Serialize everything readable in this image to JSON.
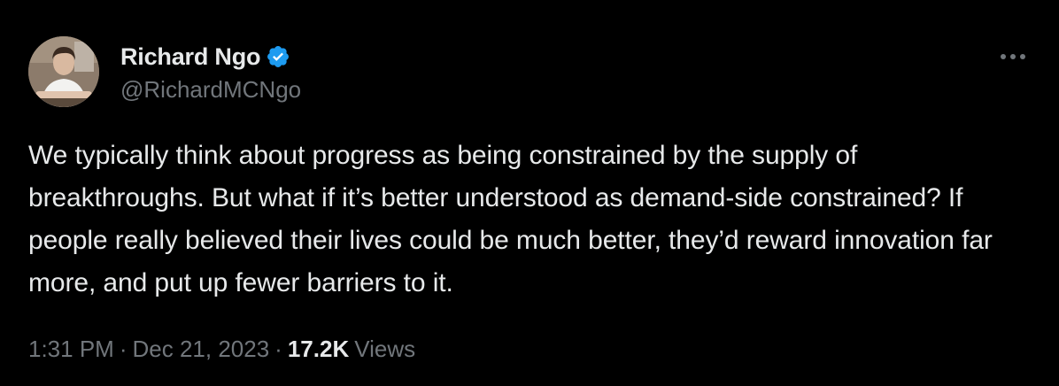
{
  "author": {
    "display_name": "Richard Ngo",
    "handle": "@RichardMCNgo",
    "verified": true,
    "avatar_icon": "profile-photo"
  },
  "tweet": {
    "text": "We typically think about progress as being constrained by the supply of breakthroughs. But what if it’s better understood as demand-side constrained? If people really believed their lives could be much better, they’d reward innovation far more, and put up fewer barriers to it."
  },
  "meta": {
    "time": "1:31 PM",
    "separator": "·",
    "date": "Dec 21, 2023",
    "views_count": "17.2K",
    "views_label": "Views"
  },
  "icons": {
    "verified": "verified-badge-icon",
    "more": "more-options-icon"
  },
  "colors": {
    "background": "#000000",
    "primary_text": "#e7e9ea",
    "secondary_text": "#71767b",
    "verified_blue": "#1d9bf0"
  }
}
